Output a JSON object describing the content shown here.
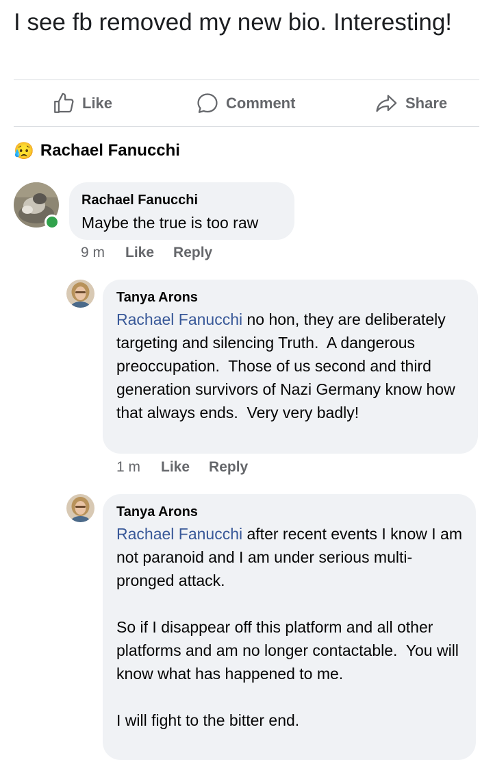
{
  "post": {
    "text": "I see fb removed my new bio. Interesting!"
  },
  "actions": {
    "like_label": "Like",
    "comment_label": "Comment",
    "share_label": "Share"
  },
  "reaction": {
    "emoji": "😥",
    "name": "Rachael Fanucchi"
  },
  "comments": [
    {
      "author": "Rachael Fanucchi",
      "text": "Maybe the true is too raw",
      "time": "9 m",
      "like_label": "Like",
      "reply_label": "Reply",
      "online": true
    },
    {
      "author": "Tanya Arons",
      "tag": "Rachael Fanucchi",
      "text": " no hon, they are deliberately targeting and silencing Truth.  A dangerous preoccupation.  Those of us second and third generation survivors of Nazi Germany know how that always ends.  Very very badly!",
      "time": "1 m",
      "like_label": "Like",
      "reply_label": "Reply"
    },
    {
      "author": "Tanya Arons",
      "tag": "Rachael Fanucchi",
      "text": " after recent events I know I am not paranoid and I am under serious multi-pronged attack.\n\nSo if I disappear off this platform and all other platforms and am no longer contactable.  You will know what has happened to me.\n\nI will fight to the bitter end."
    }
  ],
  "colors": {
    "link": "#385898",
    "bubble": "#f0f2f5",
    "online": "#31a24c",
    "muted": "#65676b"
  }
}
